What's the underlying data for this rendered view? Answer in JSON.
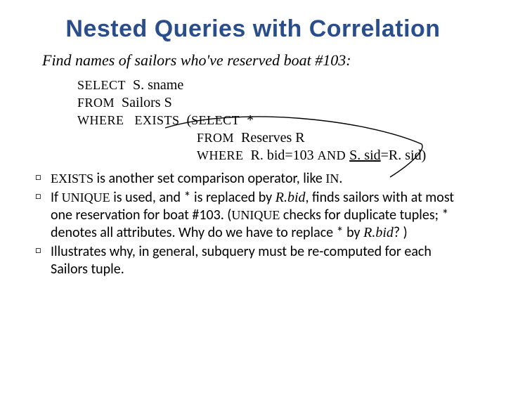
{
  "title": "Nested Queries with Correlation",
  "subtitle": "Find names of sailors who've reserved boat #103:",
  "code": {
    "l1a": "SELECT",
    "l1b": "  S. sname",
    "l2a": "FROM",
    "l2b": "  Sailors S",
    "l3a": "WHERE   EXISTS",
    "l3b": "  (",
    "l3c": "SELECT",
    "l3d": "  *",
    "l4a": "FROM",
    "l4b": "  Reserves R",
    "l5a": "WHERE",
    "l5b": "  R. bid=103 ",
    "l5c": "AND",
    "l5d": " ",
    "l5e": "S. sid",
    "l5f": "=R. sid)"
  },
  "b1": {
    "kw1": "EXISTS",
    "t1": " is another set comparison operator, like ",
    "kw2": "IN",
    "t2": "."
  },
  "b2": {
    "t1": "If ",
    "kw1": "UNIQUE",
    "t2": " is used, and * is replaced by ",
    "i1": "R.bid",
    "t3": ", finds sailors with at most one reservation for boat #103. (",
    "kw2": "UNIQUE",
    "t4": " checks for duplicate tuples; * denotes all attributes.  Why do we have to replace * by ",
    "i2": "R.bid",
    "t5": "? )"
  },
  "b3": {
    "t1": "Illustrates why, in general, subquery must be re-computed for each Sailors tuple."
  }
}
